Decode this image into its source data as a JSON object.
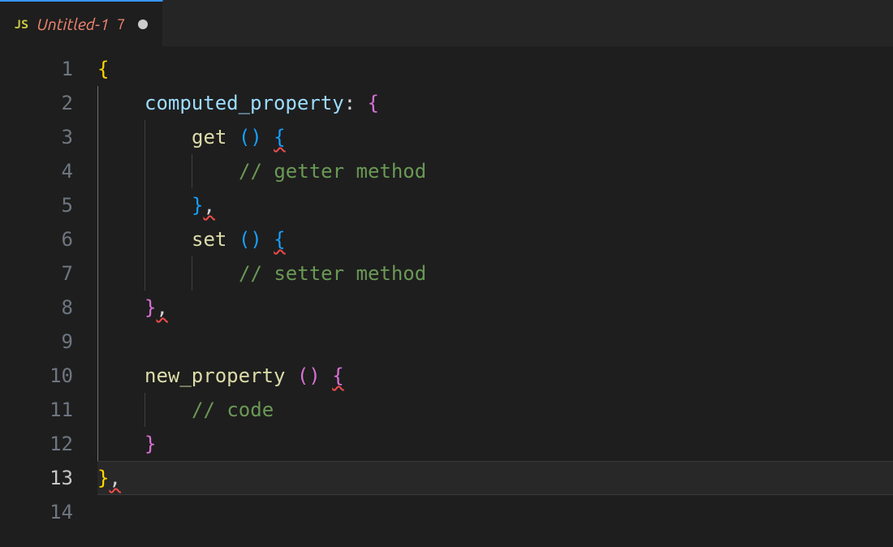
{
  "tab": {
    "language_badge": "JS",
    "title": "Untitled-1",
    "problem_count": "7",
    "dirty": true
  },
  "editor": {
    "active_line": 13,
    "line_numbers": [
      "1",
      "2",
      "3",
      "4",
      "5",
      "6",
      "7",
      "8",
      "9",
      "10",
      "11",
      "12",
      "13",
      "14"
    ],
    "tokens": {
      "l1_brace": "{",
      "l2_key": "computed_property",
      "l2_colon": ":",
      "l2_brace": "{",
      "l3_fn": "get",
      "l3_parens": "()",
      "l3_brace": "{",
      "l4_comment": "// getter method",
      "l5_brace": "}",
      "l5_comma": ",",
      "l6_fn": "set",
      "l6_parens": "()",
      "l6_brace": "{",
      "l7_comment": "// setter method",
      "l8_brace": "}",
      "l8_comma": ",",
      "l10_fn": "new_property",
      "l10_parens": "()",
      "l10_brace": "{",
      "l11_comment": "// code",
      "l12_brace": "}",
      "l13_brace": "}",
      "l13_comma": ","
    }
  }
}
